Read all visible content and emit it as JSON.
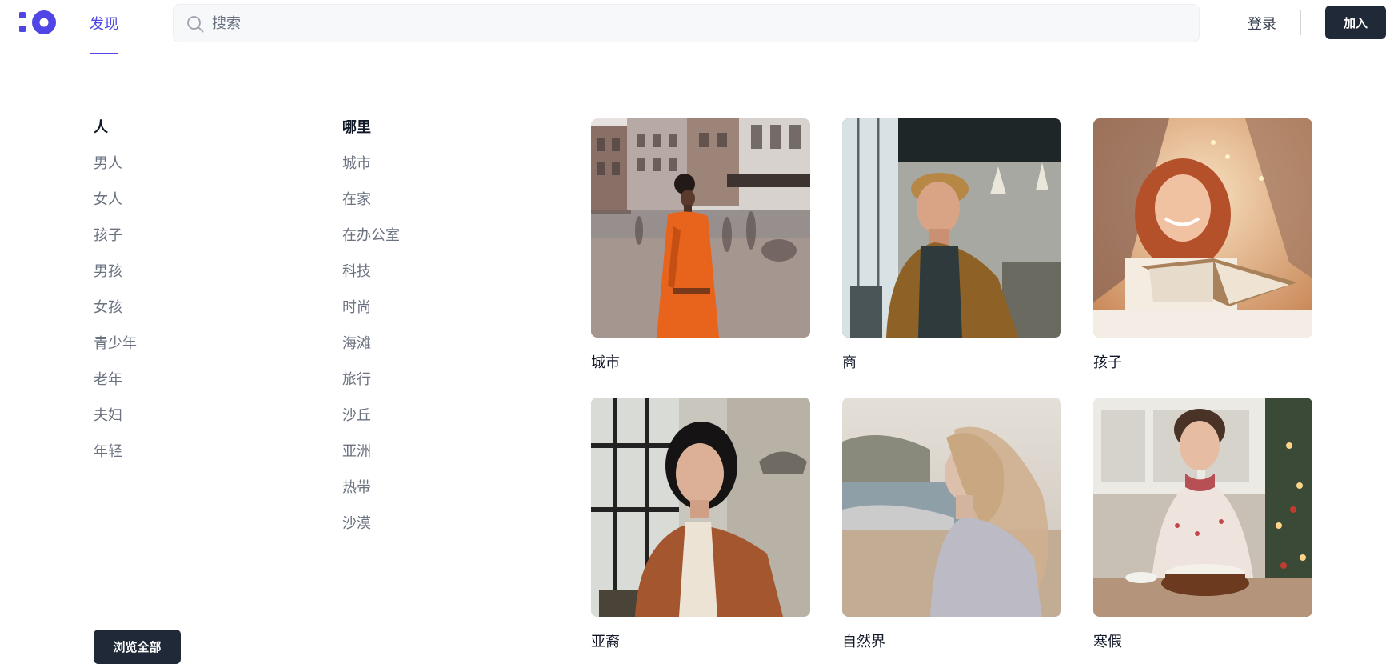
{
  "header": {
    "nav_discover": "发现",
    "search_placeholder": "搜索",
    "login": "登录",
    "join": "加入"
  },
  "categories": {
    "people": {
      "title": "人",
      "items": [
        "男人",
        "女人",
        "孩子",
        "男孩",
        "女孩",
        "青少年",
        "老年",
        "夫妇",
        "年轻"
      ]
    },
    "where": {
      "title": "哪里",
      "items": [
        "城市",
        "在家",
        "在办公室",
        "科技",
        "时尚",
        "海滩",
        "旅行",
        "沙丘",
        "亚洲",
        "热带",
        "沙漠"
      ]
    },
    "browse_all": "浏览全部"
  },
  "cards": [
    {
      "label": "城市",
      "icon": "woman-orange-coat-city-photo"
    },
    {
      "label": "商",
      "icon": "man-business-office-photo"
    },
    {
      "label": "孩子",
      "icon": "girl-reading-book-photo"
    },
    {
      "label": "亚裔",
      "icon": "asian-woman-portrait-photo"
    },
    {
      "label": "自然界",
      "icon": "woman-beach-nature-photo"
    },
    {
      "label": "寒假",
      "icon": "woman-baking-holiday-photo"
    }
  ],
  "colors": {
    "accent": "#4f46e5",
    "dark_button": "#1f2937",
    "muted_text": "#6b7280"
  }
}
